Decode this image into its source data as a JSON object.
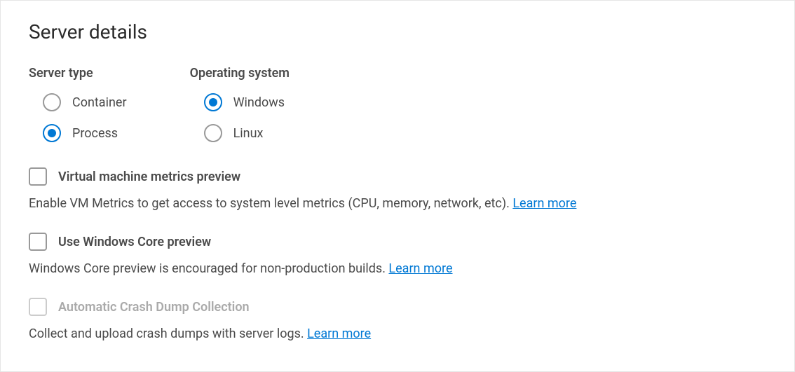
{
  "section": {
    "title": "Server details"
  },
  "serverType": {
    "label": "Server type",
    "options": [
      {
        "label": "Container",
        "selected": false
      },
      {
        "label": "Process",
        "selected": true
      }
    ]
  },
  "operatingSystem": {
    "label": "Operating system",
    "options": [
      {
        "label": "Windows",
        "selected": true
      },
      {
        "label": "Linux",
        "selected": false
      }
    ]
  },
  "vmMetrics": {
    "label": "Virtual machine metrics preview",
    "description": "Enable VM Metrics to get access to system level metrics (CPU, memory, network, etc). ",
    "learnMore": "Learn more",
    "checked": false,
    "disabled": false
  },
  "windowsCore": {
    "label": "Use Windows Core preview",
    "description": "Windows Core preview is encouraged for non-production builds. ",
    "learnMore": "Learn more",
    "checked": false,
    "disabled": false
  },
  "crashDump": {
    "label": "Automatic Crash Dump Collection",
    "description": "Collect and upload crash dumps with server logs. ",
    "learnMore": "Learn more",
    "checked": false,
    "disabled": true
  }
}
